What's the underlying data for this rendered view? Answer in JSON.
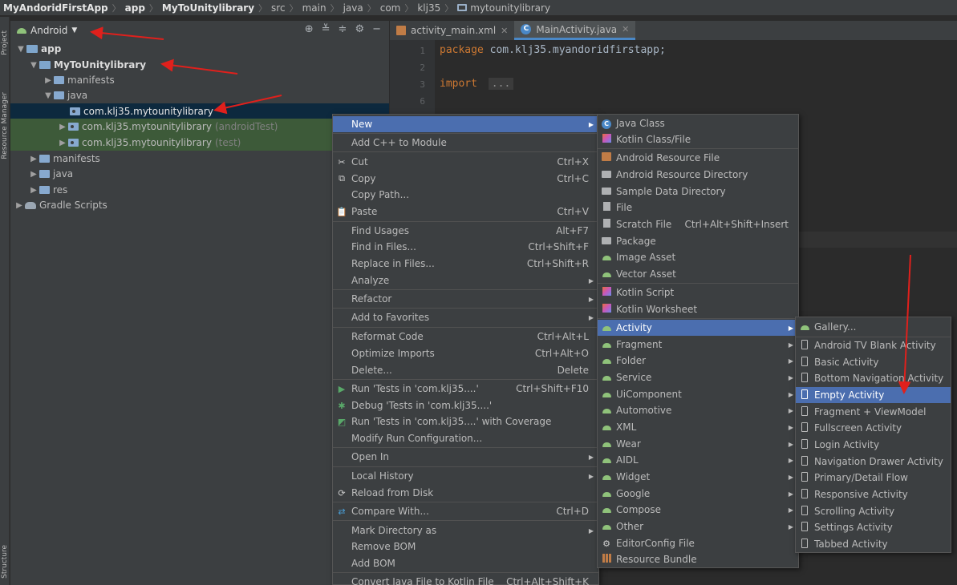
{
  "breadcrumb": {
    "items": [
      "MyAndoridFirstApp",
      "app",
      "MyToUnitylibrary",
      "src",
      "main",
      "java",
      "com",
      "klj35",
      "mytounitylibrary"
    ]
  },
  "tool_strip": {
    "project_tab": "Project",
    "resource_manager_tab": "Resource Manager",
    "structure_tab": "Structure"
  },
  "project_panel": {
    "view_selector": "Android",
    "tree": [
      {
        "label": "app"
      },
      {
        "label": "MyToUnitylibrary"
      },
      {
        "label": "manifests"
      },
      {
        "label": "java"
      },
      {
        "label": "com.klj35.mytounitylibrary"
      },
      {
        "label": "com.klj35.mytounitylibrary",
        "suffix": "(androidTest)"
      },
      {
        "label": "com.klj35.mytounitylibrary",
        "suffix": "(test)"
      },
      {
        "label": "manifests"
      },
      {
        "label": "java"
      },
      {
        "label": "res"
      },
      {
        "label": "Gradle Scripts"
      }
    ]
  },
  "editor": {
    "tabs": [
      {
        "label": "activity_main.xml"
      },
      {
        "label": "MainActivity.java"
      }
    ],
    "line_numbers": [
      "1",
      "2",
      "3",
      "6"
    ],
    "code": {
      "package_kw": "package",
      "package_name": "com.klj35.myandoridfirstapp;",
      "import_kw": "import",
      "import_fold": "..."
    }
  },
  "context_menu": {
    "items": [
      {
        "label": "New"
      },
      {
        "label": "Add C++ to Module"
      },
      {
        "label": "Cut",
        "shortcut": "Ctrl+X"
      },
      {
        "label": "Copy",
        "shortcut": "Ctrl+C"
      },
      {
        "label": "Copy Path..."
      },
      {
        "label": "Paste",
        "shortcut": "Ctrl+V"
      },
      {
        "label": "Find Usages",
        "shortcut": "Alt+F7"
      },
      {
        "label": "Find in Files...",
        "shortcut": "Ctrl+Shift+F"
      },
      {
        "label": "Replace in Files...",
        "shortcut": "Ctrl+Shift+R"
      },
      {
        "label": "Analyze"
      },
      {
        "label": "Refactor"
      },
      {
        "label": "Add to Favorites"
      },
      {
        "label": "Reformat Code",
        "shortcut": "Ctrl+Alt+L"
      },
      {
        "label": "Optimize Imports",
        "shortcut": "Ctrl+Alt+O"
      },
      {
        "label": "Delete...",
        "shortcut": "Delete"
      },
      {
        "label": "Run 'Tests in 'com.klj35....'",
        "shortcut": "Ctrl+Shift+F10"
      },
      {
        "label": "Debug 'Tests in 'com.klj35....'"
      },
      {
        "label": "Run 'Tests in 'com.klj35....' with Coverage"
      },
      {
        "label": "Modify Run Configuration..."
      },
      {
        "label": "Open In"
      },
      {
        "label": "Local History"
      },
      {
        "label": "Reload from Disk"
      },
      {
        "label": "Compare With...",
        "shortcut": "Ctrl+D"
      },
      {
        "label": "Mark Directory as"
      },
      {
        "label": "Remove BOM"
      },
      {
        "label": "Add BOM"
      },
      {
        "label": "Convert Java File to Kotlin File",
        "shortcut": "Ctrl+Alt+Shift+K"
      }
    ]
  },
  "new_submenu": {
    "items": [
      {
        "label": "Java Class"
      },
      {
        "label": "Kotlin Class/File"
      },
      {
        "label": "Android Resource File"
      },
      {
        "label": "Android Resource Directory"
      },
      {
        "label": "Sample Data Directory"
      },
      {
        "label": "File"
      },
      {
        "label": "Scratch File",
        "shortcut": "Ctrl+Alt+Shift+Insert"
      },
      {
        "label": "Package"
      },
      {
        "label": "Image Asset"
      },
      {
        "label": "Vector Asset"
      },
      {
        "label": "Kotlin Script"
      },
      {
        "label": "Kotlin Worksheet"
      },
      {
        "label": "Activity"
      },
      {
        "label": "Fragment"
      },
      {
        "label": "Folder"
      },
      {
        "label": "Service"
      },
      {
        "label": "UiComponent"
      },
      {
        "label": "Automotive"
      },
      {
        "label": "XML"
      },
      {
        "label": "Wear"
      },
      {
        "label": "AIDL"
      },
      {
        "label": "Widget"
      },
      {
        "label": "Google"
      },
      {
        "label": "Compose"
      },
      {
        "label": "Other"
      },
      {
        "label": "EditorConfig File"
      },
      {
        "label": "Resource Bundle"
      }
    ]
  },
  "activity_submenu": {
    "items": [
      {
        "label": "Gallery..."
      },
      {
        "label": "Android TV Blank Activity"
      },
      {
        "label": "Basic Activity"
      },
      {
        "label": "Bottom Navigation Activity"
      },
      {
        "label": "Empty Activity"
      },
      {
        "label": "Fragment + ViewModel"
      },
      {
        "label": "Fullscreen Activity"
      },
      {
        "label": "Login Activity"
      },
      {
        "label": "Navigation Drawer Activity"
      },
      {
        "label": "Primary/Detail Flow"
      },
      {
        "label": "Responsive Activity"
      },
      {
        "label": "Scrolling Activity"
      },
      {
        "label": "Settings Activity"
      },
      {
        "label": "Tabbed Activity"
      }
    ]
  },
  "annotation_color": "#e0201c"
}
